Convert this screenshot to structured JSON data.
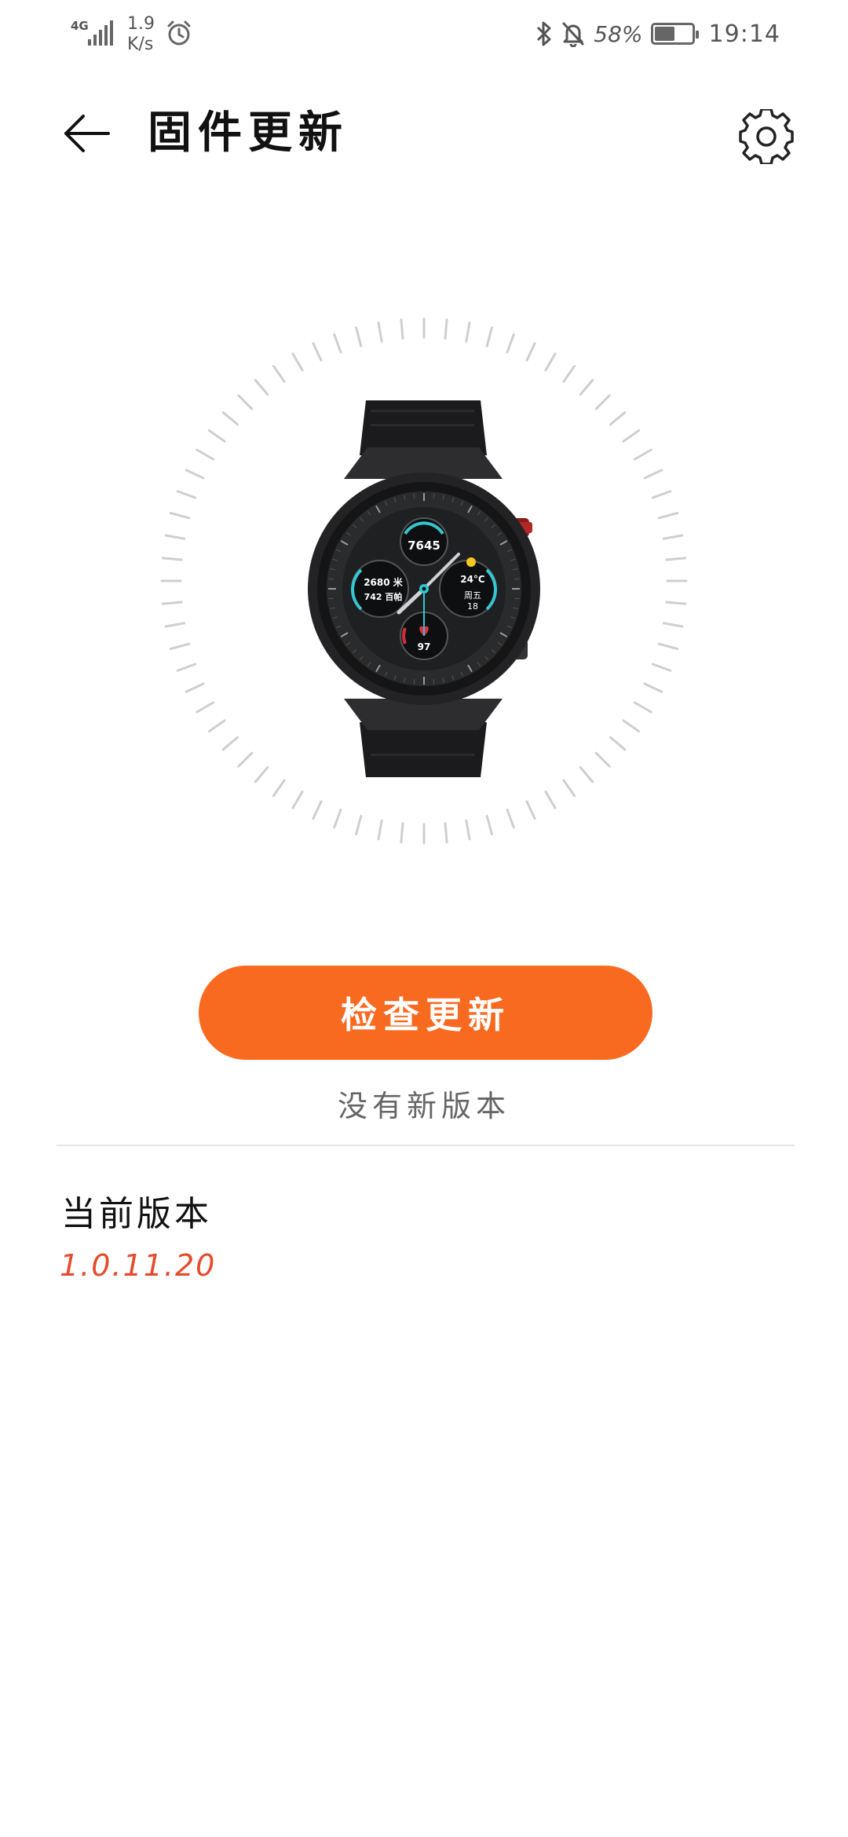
{
  "status_bar": {
    "network_type": "4G",
    "net_speed_value": "1.9",
    "net_speed_unit": "K/s",
    "battery_percent": "58%",
    "battery_level": 0.58,
    "time": "19:14",
    "icons": [
      "signal-icon",
      "alarm-icon",
      "bluetooth-icon",
      "mute-icon",
      "battery-icon"
    ]
  },
  "header": {
    "title": "固件更新",
    "back_icon": "back-arrow-icon",
    "settings_icon": "gear-icon"
  },
  "hero": {
    "image": "smartwatch",
    "watch_face": {
      "steps": "7645",
      "distance": "2680 米",
      "calories": "742 百帕",
      "temperature": "24°C",
      "day": "周五",
      "date": "18",
      "heart_rate": "97"
    }
  },
  "actions": {
    "check_update_label": "检查更新",
    "status_message": "没有新版本"
  },
  "version": {
    "label": "当前版本",
    "value": "1.0.11.20"
  },
  "colors": {
    "accent": "#f96a21",
    "version_text": "#e64a2c"
  }
}
